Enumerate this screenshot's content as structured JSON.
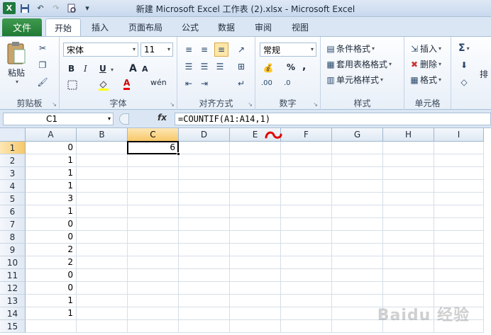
{
  "window": {
    "title": "新建 Microsoft Excel 工作表 (2).xlsx  -  Microsoft Excel"
  },
  "qat": {
    "icons": [
      "excel-icon",
      "save-icon",
      "undo-icon",
      "redo-icon",
      "print-preview-icon"
    ]
  },
  "tabs": [
    {
      "label": "文件"
    },
    {
      "label": "开始"
    },
    {
      "label": "插入"
    },
    {
      "label": "页面布局"
    },
    {
      "label": "公式"
    },
    {
      "label": "数据"
    },
    {
      "label": "审阅"
    },
    {
      "label": "视图"
    }
  ],
  "ribbon": {
    "clipboard": {
      "label": "剪贴板",
      "paste": "粘贴"
    },
    "font": {
      "label": "字体",
      "name": "宋体",
      "size": "11",
      "bold": "B",
      "italic": "I",
      "underline": "U",
      "grow": "A",
      "shrink": "A",
      "color_letter": "A",
      "phonetic": "wén"
    },
    "alignment": {
      "label": "对齐方式"
    },
    "number": {
      "label": "数字",
      "format": "常规",
      "percent": "%",
      "comma": ",",
      "inc_decimal": ".00",
      "dec_decimal": ".0"
    },
    "styles": {
      "label": "样式",
      "conditional": "条件格式",
      "table": "套用表格格式",
      "cell_styles": "单元格样式"
    },
    "cells": {
      "label": "单元格",
      "insert": "插入",
      "delete": "删除",
      "format": "格式"
    },
    "editing": {
      "sum": "Σ",
      "sort": "排"
    }
  },
  "formula_bar": {
    "name_box": "C1",
    "fx": "fx",
    "formula": "=COUNTIF(A1:A14,1)"
  },
  "sheet": {
    "columns": [
      "A",
      "B",
      "C",
      "D",
      "E",
      "F",
      "G",
      "H",
      "I"
    ],
    "selected_column": "C",
    "rows": [
      "1",
      "2",
      "3",
      "4",
      "5",
      "6",
      "7",
      "8",
      "9",
      "10",
      "11",
      "12",
      "13",
      "14",
      "15"
    ],
    "selected_row": "1",
    "col_a_values": [
      "0",
      "1",
      "1",
      "1",
      "3",
      "1",
      "0",
      "0",
      "2",
      "2",
      "0",
      "0",
      "1",
      "1"
    ],
    "c1_value": "6"
  },
  "watermark": "Baidu 经验"
}
